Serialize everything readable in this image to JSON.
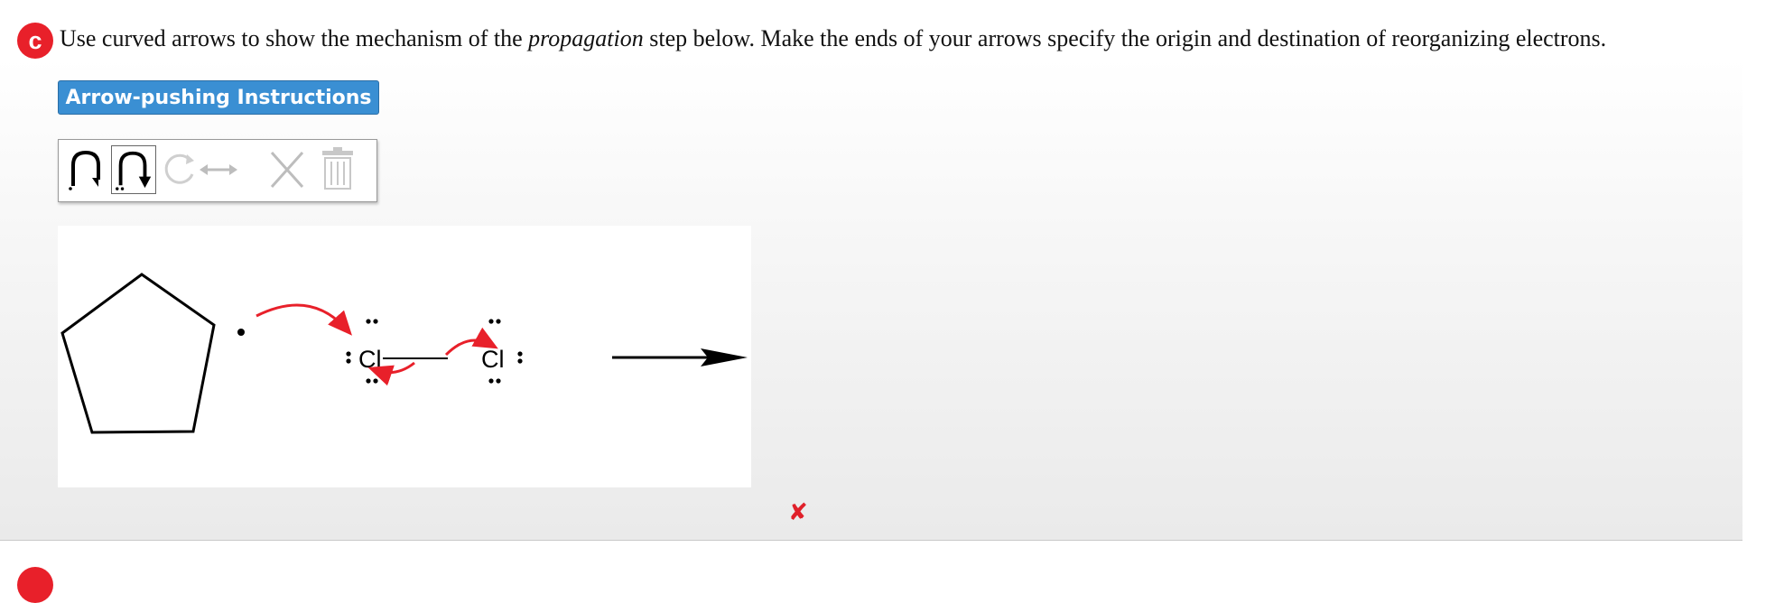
{
  "question": {
    "badge": "c",
    "prefix": "Use curved arrows to show the mechanism of the ",
    "emphasis": "propagation",
    "suffix": " step below. Make the ends of your arrows specify the origin and destination of reorganizing electrons."
  },
  "instructions_button": "Arrow-pushing Instructions",
  "toolbar": {
    "tools": [
      {
        "name": "single-electron-arrow",
        "icon": "fishhook-arrow-icon",
        "selected": false
      },
      {
        "name": "double-electron-arrow",
        "icon": "full-curved-arrow-icon",
        "selected": true
      },
      {
        "name": "redo",
        "icon": "redo-icon",
        "selected": false
      },
      {
        "name": "resonance",
        "icon": "double-headed-arrow-icon",
        "selected": false
      },
      {
        "name": "delete",
        "icon": "x-icon",
        "selected": false
      },
      {
        "name": "clear",
        "icon": "trash-icon",
        "selected": false
      }
    ]
  },
  "molecule": {
    "atom_left": "Cl",
    "atom_right": "Cl"
  },
  "result": {
    "icon": "incorrect-x-icon",
    "symbol": "✘"
  },
  "colors": {
    "accent_red": "#e8202a",
    "button_blue": "#3a8fd3",
    "arrow_red": "#e8202a"
  }
}
